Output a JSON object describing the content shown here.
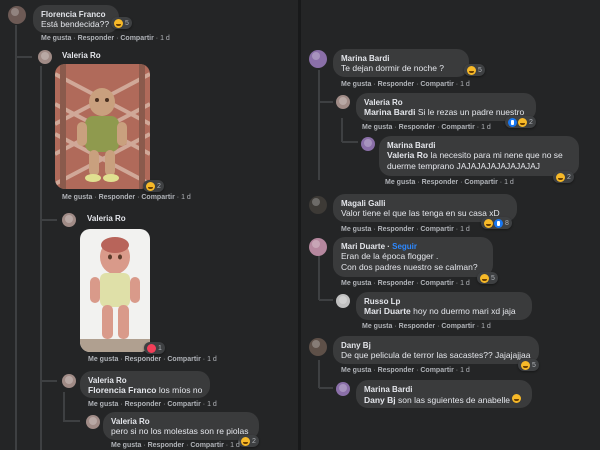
{
  "actions": {
    "like": "Me gusta",
    "reply": "Responder",
    "share": "Compartir",
    "sep": " · "
  },
  "left": [
    {
      "name": "Florencia Franco",
      "text": "Está bendecida??",
      "time": "1 d",
      "reactions": "5"
    },
    {
      "name": "Valeria Ro",
      "time": "1 d",
      "reactions": "2"
    },
    {
      "name": "Valeria Ro",
      "time": "1 d",
      "reactions": "1"
    },
    {
      "name": "Valeria Ro",
      "mention": "Florencia Franco",
      "text": " los míos no",
      "time": "1 d"
    },
    {
      "name": "Valeria Ro",
      "text": "pero si no los molestas son re piolas",
      "time": "1 d",
      "reactions": "2"
    }
  ],
  "right": [
    {
      "name": "Marina Bardi",
      "text": "Te dejan dormir de noche ?",
      "time": "1 d",
      "reactions": "5"
    },
    {
      "name": "Valeria Ro",
      "mention": "Marina Bardi",
      "text": " Si le rezas un padre nuestro",
      "time": "1 d",
      "reactions": "2"
    },
    {
      "name": "Marina Bardi",
      "mention": "Valeria Ro",
      "text": " la necesito para mi nene que no se",
      "text2": "duerme temprano JAJAJAJAJAJAJAJAJ",
      "time": "1 d",
      "reactions": "2"
    },
    {
      "name": "Magali Galli",
      "text": "Valor tiene el que las tenga en su casa xD",
      "time": "1 d",
      "reactions": "8"
    },
    {
      "name": "Mari Duarte",
      "follow": "Seguir",
      "sep": " · ",
      "text": "Eran de la época flogger .",
      "text2": "Con dos padres nuestro se calman?",
      "time": "1 d",
      "reactions": "5"
    },
    {
      "name": "Russo Lp",
      "mention": "Mari Duarte",
      "text": " hoy no duermo mari xd jaja",
      "time": "1 d"
    },
    {
      "name": "Dany Bj",
      "text": "De que pelicula de terror las sacastes?? Jajajajjaa",
      "time": "1 d",
      "reactions": "5"
    },
    {
      "name": "Marina Bardi",
      "mention": "Dany Bj",
      "text": " son las sguientes de anabelle"
    }
  ]
}
